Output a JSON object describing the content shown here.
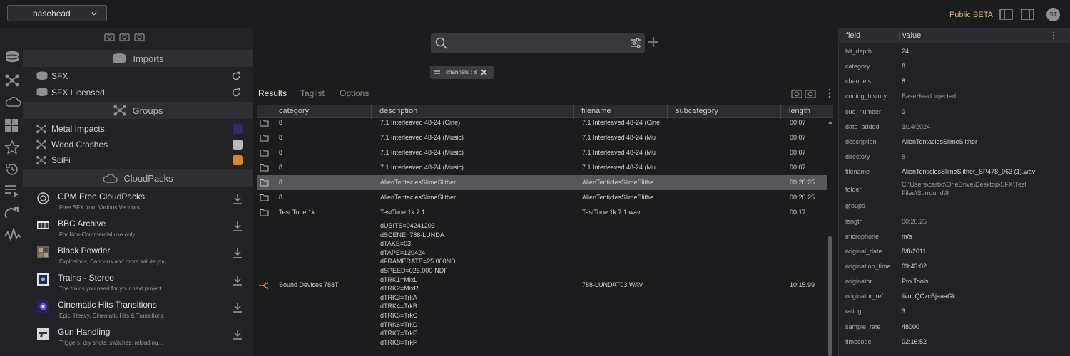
{
  "topbar": {
    "workspace": "basehead",
    "beta_label": "Public BETA",
    "avatar_initials": "ST"
  },
  "sidebar": {
    "imports_header": "Imports",
    "imports": [
      {
        "label": "SFX"
      },
      {
        "label": "SFX Licensed"
      }
    ],
    "groups_header": "Groups",
    "groups": [
      {
        "label": "Metal Impacts",
        "color": "#2f2b6a"
      },
      {
        "label": "Wood Crashes",
        "color": "#b8b8bc"
      },
      {
        "label": "SciFi",
        "color": "#d7891e"
      }
    ],
    "cloudpacks_header": "CloudPacks",
    "cloudpacks": [
      {
        "title": "CPM Free CloudPacks",
        "subtitle": "Free SFX from Various Vendors"
      },
      {
        "title": "BBC Archive",
        "subtitle": "For Non-Commercial use only."
      },
      {
        "title": "Black Powder",
        "subtitle": "Explosions, Cannons and more salute you"
      },
      {
        "title": "Trains - Stereo",
        "subtitle": "The trains you need for your next project."
      },
      {
        "title": "Cinematic Hits Transitions",
        "subtitle": "Epic, Heavy, Cinematic Hits & Transitions"
      },
      {
        "title": "Gun Handling",
        "subtitle": "Triggers, dry shots, switches, reloading..."
      }
    ]
  },
  "search": {
    "placeholder": "",
    "filter_chip": "channels : 8"
  },
  "tabs": [
    "Results",
    "Taglist",
    "Options"
  ],
  "table": {
    "columns": [
      "category",
      "description",
      "filename",
      "subcategory",
      "length"
    ],
    "rows": [
      {
        "category": "8",
        "description": "7.1 Interleaved 48-24 (Cine)",
        "filename": "7.1 Interleaved 48-24 (Cine",
        "subcategory": "",
        "length": "00:07"
      },
      {
        "category": "8",
        "description": "7.1 Interleaved 48-24 (Music)",
        "filename": "7.1 Interleaved 48-24 (Mu",
        "subcategory": "",
        "length": "00:07"
      },
      {
        "category": "8",
        "description": "7.1 Interleaved 48-24 (Music)",
        "filename": "7.1 Interleaved 48-24 (Mu",
        "subcategory": "",
        "length": "00:07"
      },
      {
        "category": "8",
        "description": "7.1 Interleaved 48-24 (Music)",
        "filename": "7.1 Interleaved 48-24 (Mu",
        "subcategory": "",
        "length": "00:07"
      },
      {
        "category": "8",
        "description": "AlienTentaclesSlimeSlither",
        "filename": "AlienTenticlesSlimeSlithe",
        "subcategory": "",
        "length": "00:20.25"
      },
      {
        "category": "8",
        "description": "AlienTentaclesSlimeSlither",
        "filename": "AlienTenticlesSlimeSlithe",
        "subcategory": "",
        "length": "00:20.25"
      },
      {
        "category": "Test Tone 1k",
        "description": "TestTone 1k 7.1",
        "filename": "TestTone 1k 7.1.wav",
        "subcategory": "",
        "length": "00:17"
      }
    ],
    "multiline_row": {
      "category": "Sound Devices 788T",
      "description_lines": [
        "dUBITS=04241203",
        "dSCENE=788-LUNDA",
        "dTAKE=03",
        "dTAPE=120424",
        "dFRAMERATE=25.000ND",
        "dSPEED=025.000-NDF",
        "dTRK1=MixL",
        "dTRK2=MixR",
        "dTRK3=TrkA",
        "dTRK4=TrkB",
        "dTRK5=TrkC",
        "dTRK6=TrkD",
        "dTRK7=TrkE",
        "dTRK8=TrkF"
      ],
      "filename": "788-LUNDAT03.WAV",
      "length": "10:15.99"
    }
  },
  "properties": {
    "header_field": "field",
    "header_value": "value",
    "items": [
      {
        "field": "bit_depth",
        "value": "24"
      },
      {
        "field": "category",
        "value": "8"
      },
      {
        "field": "channels",
        "value": "8"
      },
      {
        "field": "coding_history",
        "value": "BaseHead Injected"
      },
      {
        "field": "cue_number",
        "value": "0"
      },
      {
        "field": "date_added",
        "value": "3/14/2024"
      },
      {
        "field": "description",
        "value": "AlienTentaclesSlimeSlither"
      },
      {
        "field": "directory",
        "value": "8"
      },
      {
        "field": "filename",
        "value": "AlienTenticlesSlimeSlither_SP478_063 (1).wav"
      },
      {
        "field": "folder",
        "value": "C:\\Users\\carbo\\OneDrive\\Desktop\\SFX\\Test",
        "value2": "Files\\Surround\\8"
      },
      {
        "field": "groups",
        "value": ""
      },
      {
        "field": "length",
        "value": "00:20.25"
      },
      {
        "field": "microphone",
        "value": "m/s"
      },
      {
        "field": "original_date",
        "value": "8/8/2011"
      },
      {
        "field": "origination_time",
        "value": "09:43:02"
      },
      {
        "field": "originator",
        "value": "Pro Tools"
      },
      {
        "field": "originator_ref",
        "value": "livuhQCzcBjaaaGk"
      },
      {
        "field": "rating",
        "value": "3"
      },
      {
        "field": "sample_rate",
        "value": "48000"
      },
      {
        "field": "timecode",
        "value": "02:16:52"
      }
    ]
  }
}
